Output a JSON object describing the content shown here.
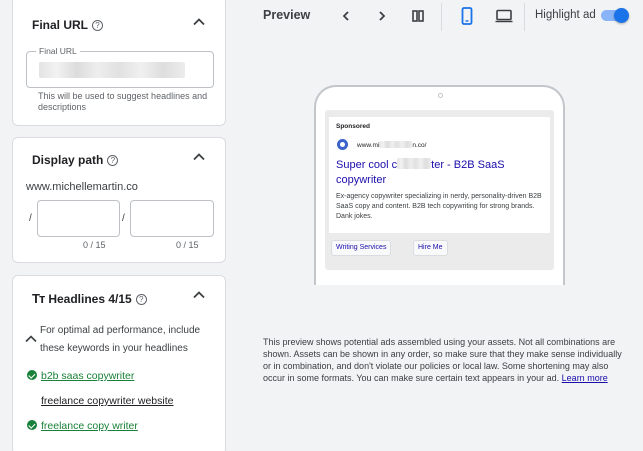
{
  "final_url": {
    "title": "Final URL",
    "field_legend": "Final URL",
    "hint": "This will be used to suggest headlines and descriptions"
  },
  "display_path": {
    "title": "Display path",
    "domain": "www.michellemartin.co",
    "separator": "/",
    "path1_counter": "0 / 15",
    "path2_counter": "0 / 15"
  },
  "headlines": {
    "title": "Headlines 4/15",
    "tip": "For optimal ad performance, include these keywords in your headlines",
    "keywords": [
      {
        "text": "b2b saas copywriter",
        "included": true
      },
      {
        "text": "freelance copywriter website",
        "included": false
      },
      {
        "text": "freelance copy writer",
        "included": true
      }
    ]
  },
  "preview": {
    "title": "Preview",
    "highlight_label": "Highlight ad",
    "highlight_on": true,
    "selected_device": "mobile",
    "ad": {
      "sponsored": "Sponsored",
      "url_start": "www.mi",
      "url_end": "n.co/",
      "title_start": "Super cool c",
      "title_end": "ter - B2B SaaS copywriter",
      "description": "Ex-agency copywriter specializing in nerdy, personality-driven B2B SaaS copy and content. B2B tech copywriting for strong brands. Dank jokes.",
      "sitelinks": [
        "Writing Services",
        "Hire Me"
      ]
    },
    "disclaimer": "This preview shows potential ads assembled using your assets. Not all combinations are shown. Assets can be shown in any order, so make sure that they make sense individually or in combination, and don't violate our policies or local law. Some shortening may also occur in some formats. You can make sure certain text appears in your ad.",
    "learn_more": "Learn more"
  },
  "colors": {
    "accent": "#1a73e8",
    "link": "#1a0dab",
    "success": "#188038",
    "panel_bg": "#f1f3f4"
  }
}
